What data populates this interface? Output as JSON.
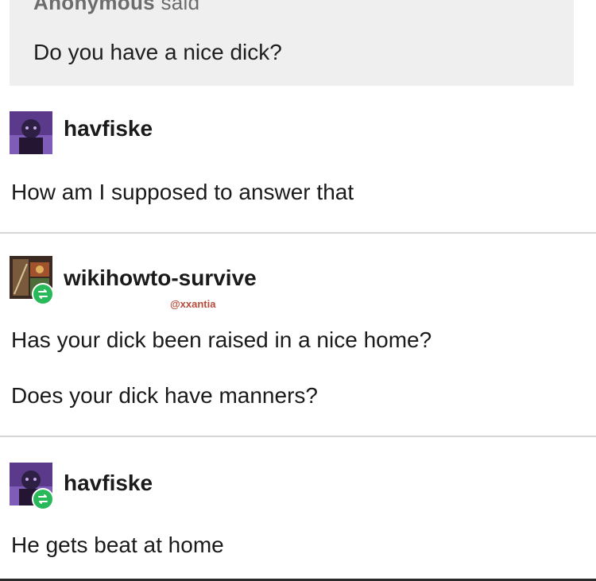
{
  "ask": {
    "asker": "Anonymous",
    "said_label": "said",
    "question": "Do you have a nice dick?"
  },
  "posts": [
    {
      "username": "havfiske",
      "avatar_icon": "purple-portrait-avatar",
      "reblogged": false,
      "lines": [
        "How am I supposed to answer that"
      ]
    },
    {
      "username": "wikihowto-survive",
      "avatar_icon": "album-art-avatar",
      "reblogged": true,
      "handle": "@xxantia",
      "lines": [
        "Has your dick been raised in a nice home?",
        "Does your dick have manners?"
      ]
    },
    {
      "username": "havfiske",
      "avatar_icon": "purple-portrait-avatar",
      "reblogged": true,
      "lines": [
        "He gets beat at home"
      ]
    }
  ],
  "colors": {
    "ask_background": "#efefef",
    "reblog_badge": "#29b95a",
    "handle": "#b84a3a",
    "divider": "#d6d6d6"
  }
}
